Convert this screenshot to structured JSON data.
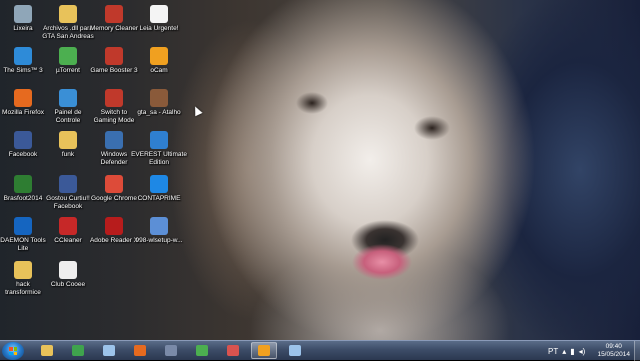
{
  "desktop": {
    "icons": [
      {
        "label": "Lixeira",
        "icon": "recycle-bin-icon",
        "color": "#8fa6b8"
      },
      {
        "label": "Archivos .dll para\nGTA San Andreas",
        "icon": "folder-icon",
        "color": "#e8c25a"
      },
      {
        "label": "Memory Cleaner",
        "icon": "memory-cleaner-icon",
        "color": "#c0392b"
      },
      {
        "label": "Leia Urgente!",
        "icon": "text-document-icon",
        "color": "#f4f4f4"
      },
      {
        "label": "The Sims™ 3",
        "icon": "sims-icon",
        "color": "#2e8bd8"
      },
      {
        "label": "µTorrent",
        "icon": "utorrent-icon",
        "color": "#4caf50"
      },
      {
        "label": "Game Booster 3",
        "icon": "game-booster-icon",
        "color": "#c0392b"
      },
      {
        "label": "oCam",
        "icon": "ocam-icon",
        "color": "#f0a020"
      },
      {
        "label": "Mozilla Firefox",
        "icon": "firefox-icon",
        "color": "#e66a1f"
      },
      {
        "label": "Painel de\nControle",
        "icon": "control-panel-icon",
        "color": "#3a8fd6"
      },
      {
        "label": "Switch to\nGaming Mode",
        "icon": "gaming-mode-icon",
        "color": "#c0392b"
      },
      {
        "label": "gta_sa - Atalho",
        "icon": "gta-shortcut-icon",
        "color": "#8a5a3a"
      },
      {
        "label": "Facebook",
        "icon": "facebook-icon",
        "color": "#3b5998"
      },
      {
        "label": "funk",
        "icon": "folder-icon",
        "color": "#e8c25a"
      },
      {
        "label": "Windows\nDefender",
        "icon": "windows-defender-icon",
        "color": "#3a6fb0"
      },
      {
        "label": "EVEREST Ultimate\nEdition",
        "icon": "everest-icon",
        "color": "#2f7fd0"
      },
      {
        "label": "Brasfoot2014",
        "icon": "brasfoot-icon",
        "color": "#2e7d32"
      },
      {
        "label": "Gostou Curtiu!!\nFacebook",
        "icon": "facebook-like-icon",
        "color": "#3b5998"
      },
      {
        "label": "Google Chrome",
        "icon": "chrome-icon",
        "color": "#dd4b39"
      },
      {
        "label": "CONTAPRIME",
        "icon": "contaprime-icon",
        "color": "#1e88e5"
      },
      {
        "label": "DAEMON Tools\nLite",
        "icon": "daemon-tools-icon",
        "color": "#1565c0"
      },
      {
        "label": "CCleaner",
        "icon": "ccleaner-icon",
        "color": "#c62828"
      },
      {
        "label": "Adobe Reader X",
        "icon": "adobe-reader-icon",
        "color": "#b71c1c"
      },
      {
        "label": "998-wlsetup-w...",
        "icon": "windows-live-setup-icon",
        "color": "#5c8fd6"
      },
      {
        "label": "hack\ntransformice",
        "icon": "folder-icon",
        "color": "#e8c25a"
      },
      {
        "label": "Club Cooee",
        "icon": "club-cooee-icon",
        "color": "#eeeeee"
      }
    ]
  },
  "taskbar": {
    "start_icon": "windows-start-icon",
    "pinned": [
      {
        "icon": "explorer-icon",
        "color": "#e8c25a"
      },
      {
        "icon": "media-player-icon",
        "color": "#3fa34d"
      },
      {
        "icon": "search-icon",
        "color": "#9cc3ea"
      },
      {
        "icon": "firefox-icon",
        "color": "#e66a1f"
      },
      {
        "icon": "app-icon",
        "color": "#7a8aa8"
      },
      {
        "icon": "utorrent-icon",
        "color": "#4caf50"
      },
      {
        "icon": "paint-icon",
        "color": "#d9534f"
      },
      {
        "icon": "media-icon",
        "color": "#f0a020"
      },
      {
        "icon": "window-icon",
        "color": "#9cc3ea"
      }
    ],
    "tray": {
      "language": "PT",
      "time": "09:40",
      "date": "15/05/2014"
    }
  }
}
